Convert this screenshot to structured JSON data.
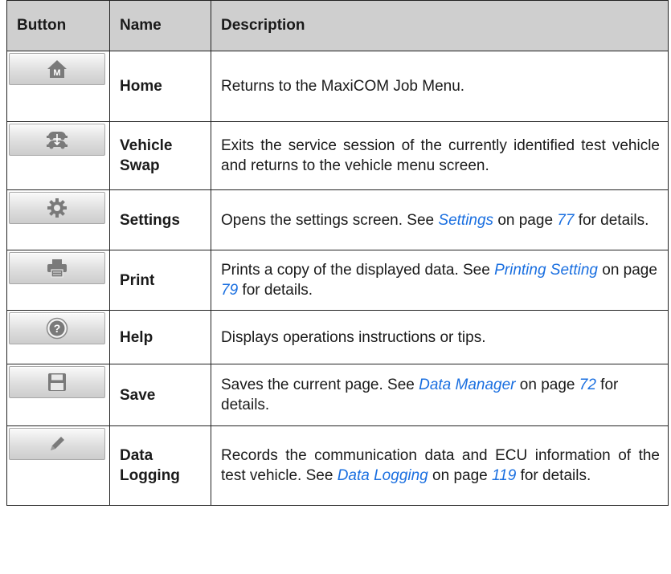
{
  "header": {
    "col_button": "Button",
    "col_name": "Name",
    "col_desc": "Description"
  },
  "rows": [
    {
      "icon": "home-icon",
      "name": "Home",
      "desc": [
        "Returns to the MaxiCOM Job Menu."
      ]
    },
    {
      "icon": "vehicle-swap-icon",
      "name": "Vehicle Swap",
      "desc": [
        "Exits the service session of the currently identified test vehicle and returns to the vehicle menu screen."
      ]
    },
    {
      "icon": "gear-icon",
      "name": "Settings",
      "desc": [
        "Opens the settings screen. See ",
        "Settings",
        " on page ",
        "77",
        " for details."
      ]
    },
    {
      "icon": "printer-icon",
      "name": "Print",
      "desc": [
        "Prints a copy of the displayed data. See ",
        "Printing Setting",
        " on page ",
        "79",
        " for details."
      ]
    },
    {
      "icon": "help-icon",
      "name": "Help",
      "desc": [
        "Displays operations instructions or tips."
      ]
    },
    {
      "icon": "save-icon",
      "name": "Save",
      "desc": [
        "Saves the current page. See ",
        "Data Manager",
        " on page ",
        "72",
        " for details."
      ]
    },
    {
      "icon": "pencil-icon",
      "name": "Data Logging",
      "desc": [
        "Records the communication data and ECU information of the test vehicle. See ",
        "Data Logging",
        " on page ",
        "119",
        " for details."
      ]
    }
  ]
}
